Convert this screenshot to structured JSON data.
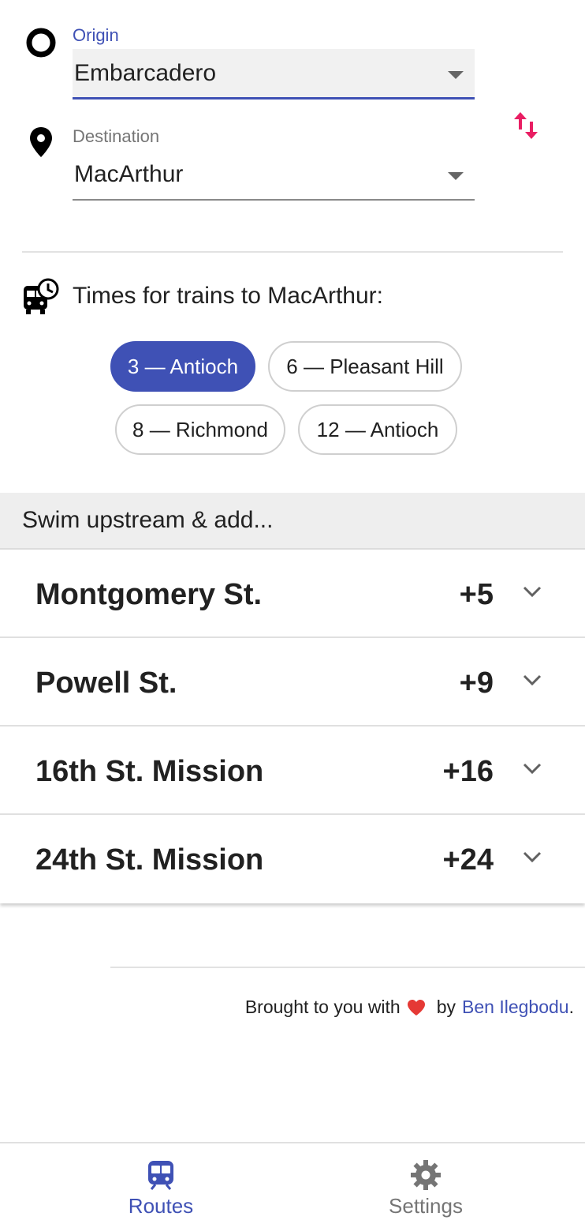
{
  "origin": {
    "label": "Origin",
    "value": "Embarcadero",
    "icon": "origin-circle-icon"
  },
  "destination": {
    "label": "Destination",
    "value": "MacArthur",
    "icon": "map-pin-icon"
  },
  "swap": {
    "icon": "swap-vertical-icon"
  },
  "times": {
    "icon": "bus-clock-icon",
    "heading": "Times for trains to MacArthur:",
    "chips": [
      {
        "label": "3 — Antioch",
        "active": true
      },
      {
        "label": "6 — Pleasant Hill",
        "active": false
      },
      {
        "label": "8 — Richmond",
        "active": false
      },
      {
        "label": "12 — Antioch",
        "active": false
      }
    ]
  },
  "upstream": {
    "heading": "Swim upstream & add...",
    "stations": [
      {
        "name": "Montgomery St.",
        "minutes": "+5"
      },
      {
        "name": "Powell St.",
        "minutes": "+9"
      },
      {
        "name": "16th St. Mission",
        "minutes": "+16"
      },
      {
        "name": "24th St. Mission",
        "minutes": "+24"
      }
    ]
  },
  "footer": {
    "prefix": "Brought to you with",
    "middle": "by",
    "author": "Ben Ilegbodu",
    "suffix": "."
  },
  "nav": [
    {
      "label": "Routes",
      "icon": "train-icon",
      "active": true
    },
    {
      "label": "Settings",
      "icon": "gear-icon",
      "active": false
    }
  ],
  "colors": {
    "primary": "#3f51b5",
    "accent": "#e91e63",
    "heart": "#e53935"
  }
}
